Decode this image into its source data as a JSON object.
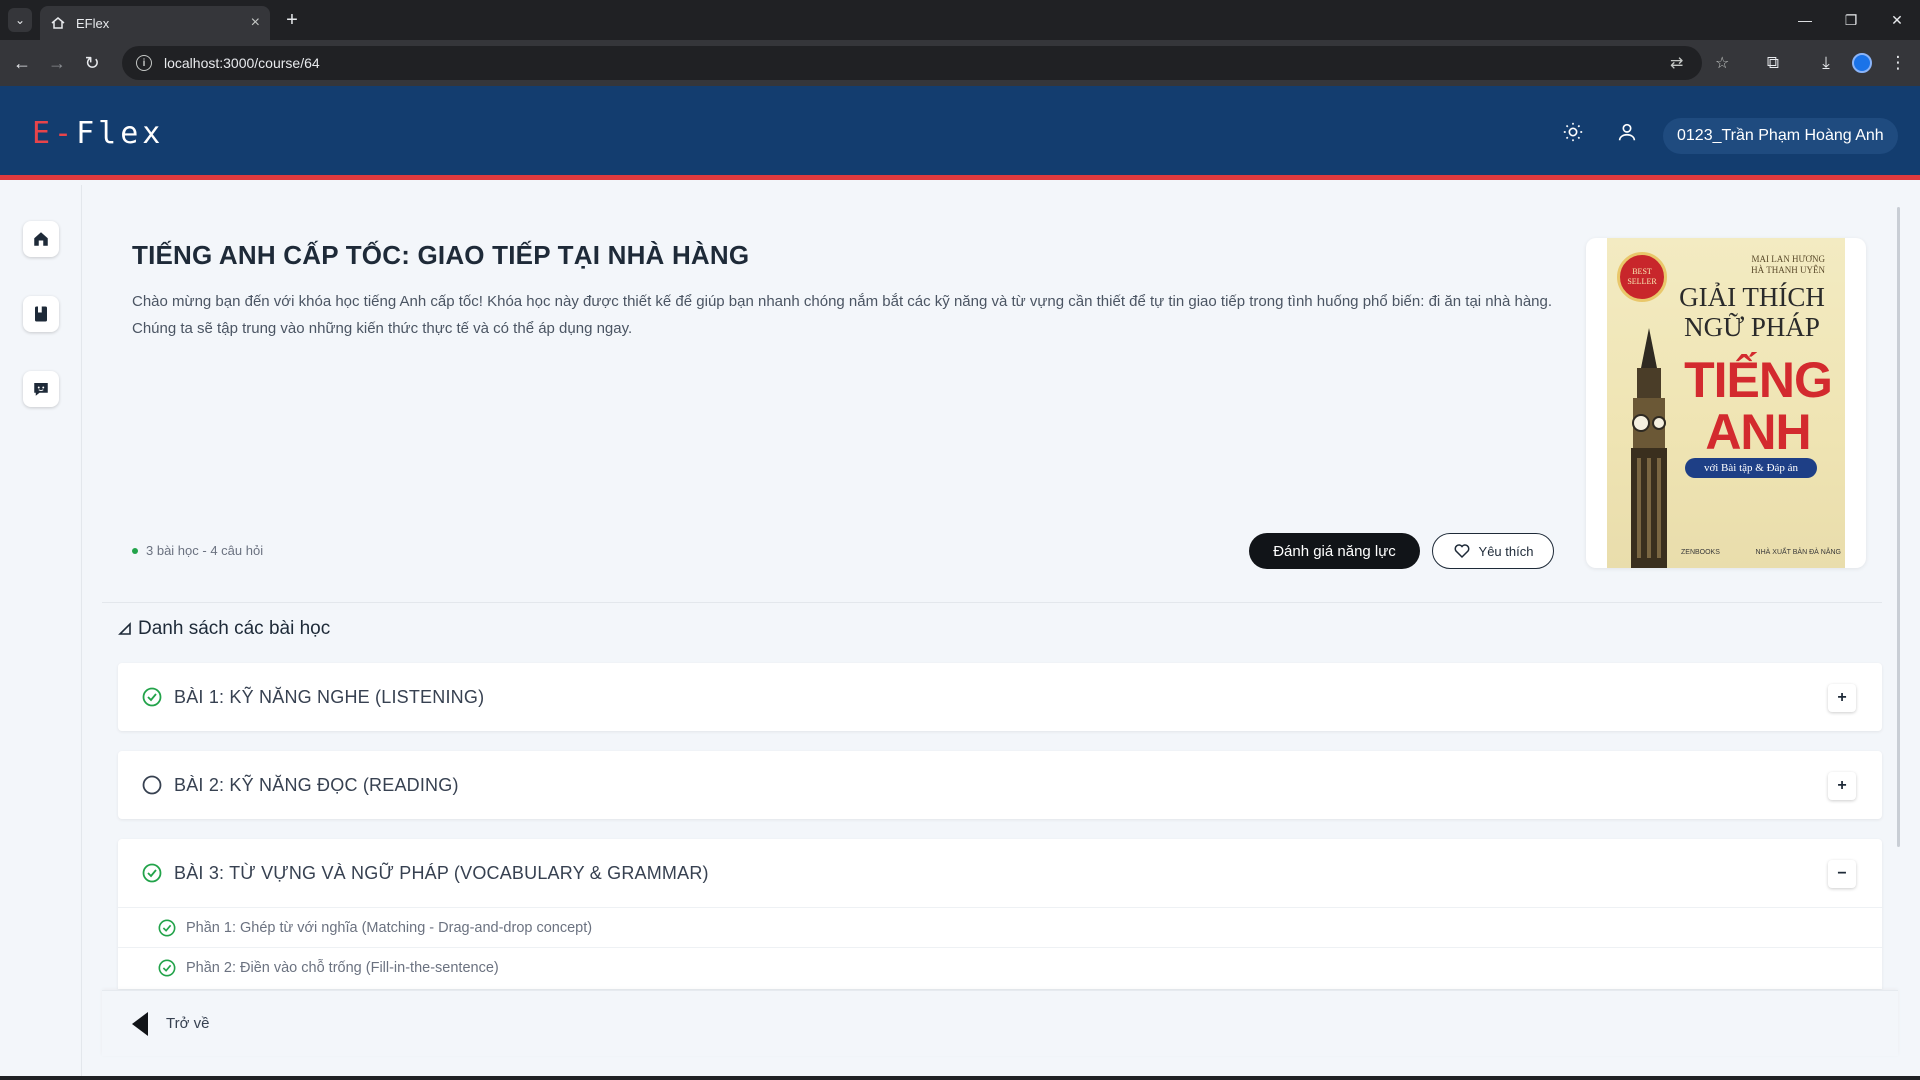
{
  "browser": {
    "tab_title": "EFlex",
    "url": "localhost:3000/course/64"
  },
  "header": {
    "logo_e": "E-",
    "logo_flex": "Flex",
    "user_name": "0123_Trần Phạm Hoàng Anh"
  },
  "course": {
    "title": "TIẾNG ANH CẤP TỐC: GIAO TIẾP TẠI NHÀ HÀNG",
    "description": "Chào mừng bạn đến với khóa học tiếng Anh cấp tốc! Khóa học này được thiết kế để giúp bạn nhanh chóng nắm bắt các kỹ năng và từ vựng cần thiết để tự tin giao tiếp trong tình huống phổ biến: đi ăn tại nhà hàng. Chúng ta sẽ tập trung vào những kiến thức thực tế và có thể áp dụng ngay.",
    "meta": "3 bài học - 4 câu hỏi",
    "assess_label": "Đánh giá năng lực",
    "favorite_label": "Yêu thích"
  },
  "cover": {
    "badge": "BEST SELLER",
    "authors": [
      "MAI LAN HƯƠNG",
      "HÀ THANH UYÊN"
    ],
    "line1": "GIẢI THÍCH NGỮ PHÁP",
    "line2": "TIẾNG ANH",
    "subtitle": "với Bài tập & Đáp án",
    "publisher_left": "ZENBOOKS",
    "publisher_right": "NHÀ XUẤT BẢN ĐÀ NẴNG"
  },
  "lessons_header": "Danh sách các bài học",
  "lessons": [
    {
      "title": "BÀI 1: KỸ NĂNG NGHE (LISTENING)",
      "done": true,
      "toggle": "+"
    },
    {
      "title": "BÀI 2: KỸ NĂNG ĐỌC (READING)",
      "done": false,
      "toggle": "+"
    },
    {
      "title": "BÀI 3: TỪ VỰNG VÀ NGỮ PHÁP (VOCABULARY & GRAMMAR)",
      "done": true,
      "toggle": "−",
      "parts": [
        {
          "label": "Phần 1: Ghép từ với nghĩa (Matching - Drag-and-drop concept)",
          "done": true
        },
        {
          "label": "Phần 2: Điền vào chỗ trống (Fill-in-the-sentence)",
          "done": true
        }
      ]
    }
  ],
  "footer": {
    "back_label": "Trở về"
  },
  "colors": {
    "header_bg": "#133d6f",
    "accent_red": "#e03a3e",
    "success_green": "#22a34a"
  }
}
